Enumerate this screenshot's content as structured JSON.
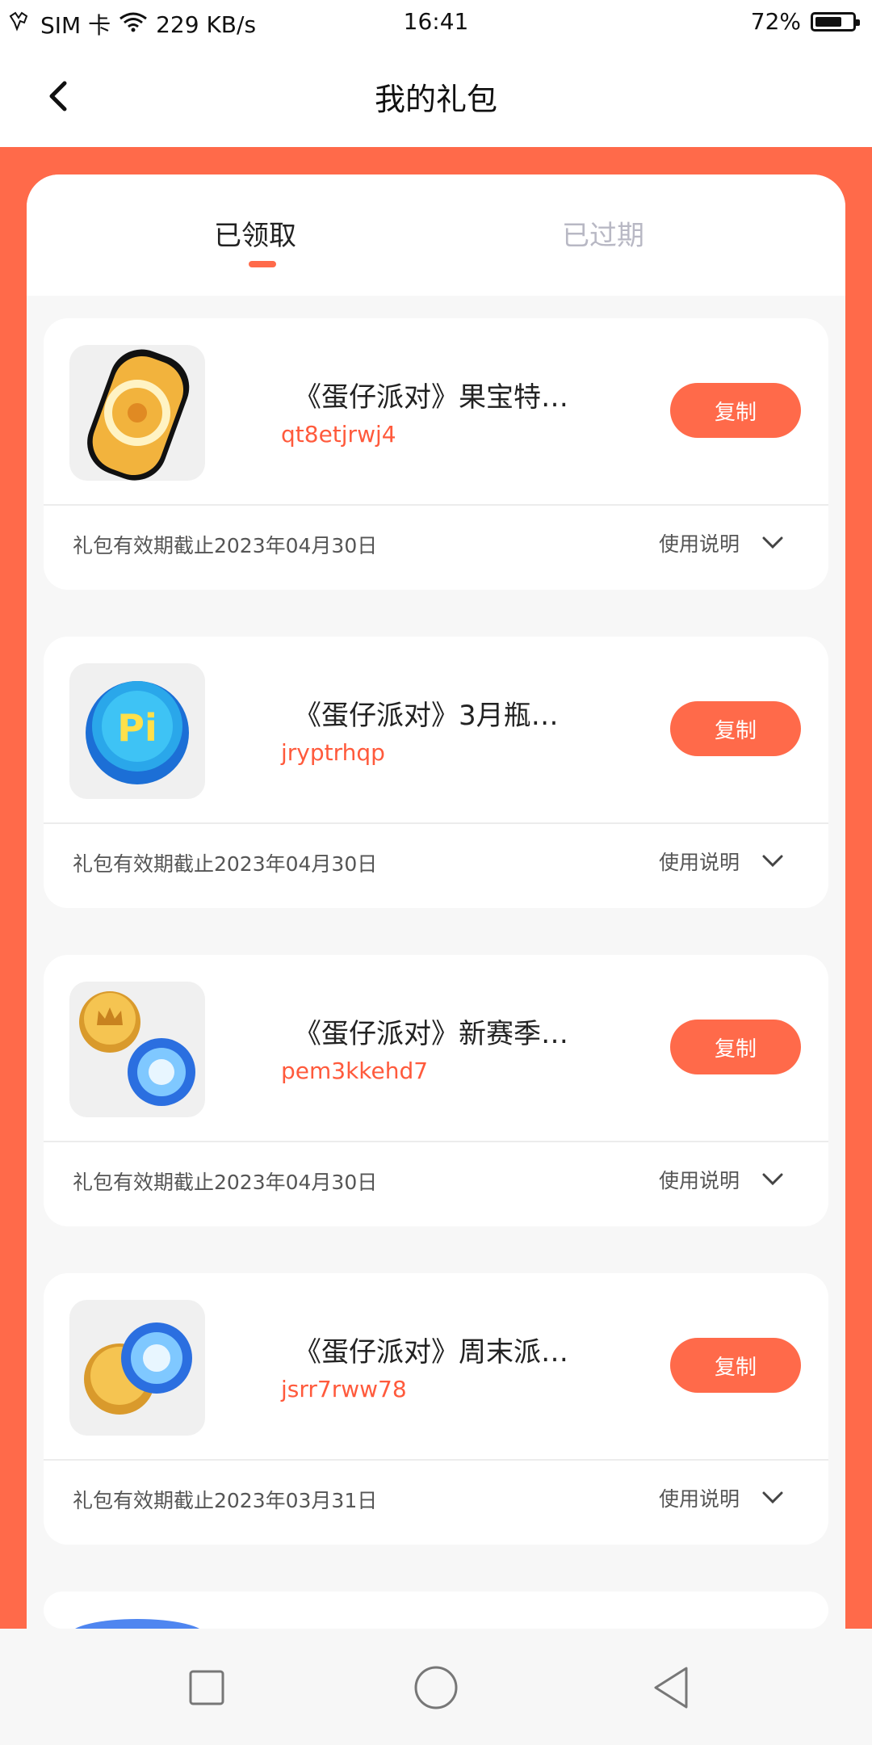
{
  "status_bar": {
    "carrier": "SIM 卡",
    "speed": "229 KB/s",
    "time": "16:41",
    "battery_percent": "72%",
    "battery_level": 0.72
  },
  "header": {
    "title": "我的礼包"
  },
  "tabs": [
    {
      "label": "已领取",
      "active": true
    },
    {
      "label": "已过期",
      "active": false
    }
  ],
  "gifts": [
    {
      "name": "《蛋仔派对》果宝特…",
      "code": "qt8etjrwj4",
      "copy_label": "复制",
      "expiry": "礼包有效期截止2023年04月30日",
      "usage_label": "使用说明",
      "icon": "gold-coin-icon"
    },
    {
      "name": "《蛋仔派对》3月瓶…",
      "code": "jryptrhqp",
      "copy_label": "复制",
      "expiry": "礼包有效期截止2023年04月30日",
      "usage_label": "使用说明",
      "icon": "bottle-cap-icon"
    },
    {
      "name": "《蛋仔派对》新赛季…",
      "code": "pem3kkehd7",
      "copy_label": "复制",
      "expiry": "礼包有效期截止2023年04月30日",
      "usage_label": "使用说明",
      "icon": "crown-coin-and-orb-icon"
    },
    {
      "name": "《蛋仔派对》周末派…",
      "code": "jsrr7rww78",
      "copy_label": "复制",
      "expiry": "礼包有效期截止2023年03月31日",
      "usage_label": "使用说明",
      "icon": "coin-and-orb-icon"
    }
  ],
  "colors": {
    "accent": "#ff6a4a",
    "code_text": "#ff5a3c",
    "inactive_tab": "#b8b8c4"
  }
}
